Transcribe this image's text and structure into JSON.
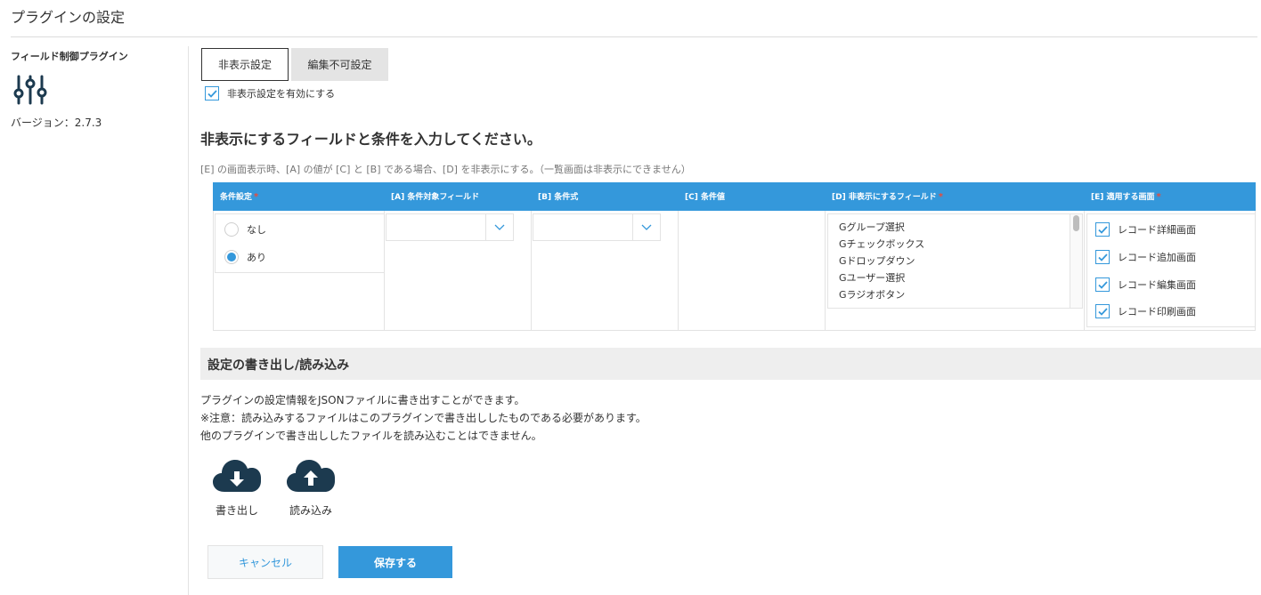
{
  "page": {
    "title": "プラグインの設定"
  },
  "plugin": {
    "name": "フィールド制御プラグイン",
    "icon": "sliders-icon",
    "version": "バージョン：2.7.3"
  },
  "tabs": [
    {
      "label": "非表示設定",
      "active": true
    },
    {
      "label": "編集不可設定",
      "active": false
    }
  ],
  "enable": {
    "label": "非表示設定を有効にする",
    "checked": true
  },
  "section": {
    "heading": "非表示にするフィールドと条件を入力してください。",
    "note": "[E] の画面表示時、[A] の値が [C] と [B] である場合、[D] を非表示にする。（一覧画面は非表示にできません）"
  },
  "table": {
    "headers": [
      {
        "label": "条件設定",
        "required": true
      },
      {
        "label": "[A] 条件対象フィールド",
        "required": false
      },
      {
        "label": "[B] 条件式",
        "required": false
      },
      {
        "label": "[C] 条件値",
        "required": false
      },
      {
        "label": "[D] 非表示にするフィールド",
        "required": true
      },
      {
        "label": "[E] 適用する画面",
        "required": true
      }
    ],
    "required_mark": "*",
    "condition_options": [
      {
        "label": "なし",
        "selected": false
      },
      {
        "label": "あり",
        "selected": true
      }
    ],
    "field_select_value": "",
    "operator_select_value": "",
    "hide_fields": [
      "Gグループ選択",
      "Gチェックボックス",
      "Gドロップダウン",
      "Gユーザー選択",
      "Gラジオボタン"
    ],
    "screens": [
      {
        "label": "レコード詳細画面",
        "checked": true
      },
      {
        "label": "レコード追加画面",
        "checked": true
      },
      {
        "label": "レコード編集画面",
        "checked": true
      },
      {
        "label": "レコード印刷画面",
        "checked": true
      }
    ]
  },
  "export": {
    "heading": "設定の書き出し/読み込み",
    "lines": [
      "プラグインの設定情報をJSONファイルに書き出すことができます。",
      "※注意：読み込みするファイルはこのプラグインで書き出ししたものである必要があります。",
      "他のプラグインで書き出ししたファイルを読み込むことはできません。"
    ],
    "download_label": "書き出し",
    "upload_label": "読み込み"
  },
  "actions": {
    "cancel": "キャンセル",
    "save": "保存する"
  },
  "colors": {
    "accent": "#3498db",
    "required": "#e74c3c",
    "icon": "#1c3a4f"
  }
}
